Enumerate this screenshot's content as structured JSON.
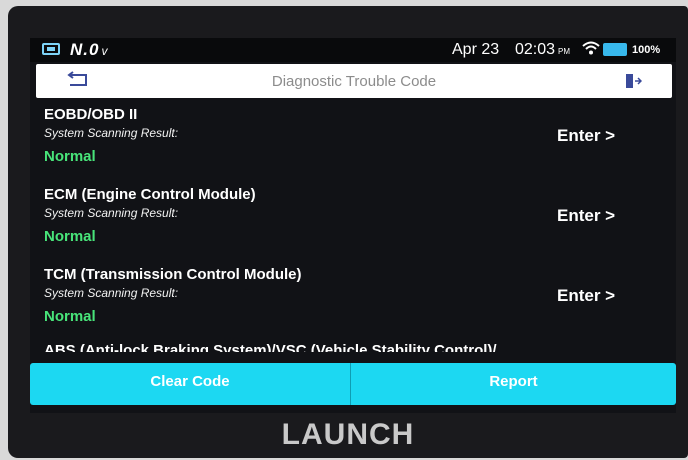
{
  "status_bar": {
    "voltage": "N.0",
    "voltage_unit": "v",
    "date": "Apr 23",
    "time": "02:03",
    "ampm": "PM",
    "battery_percent": "100%"
  },
  "header": {
    "title": "Diagnostic Trouble Code"
  },
  "modules": [
    {
      "title": "EOBD/OBD II",
      "subtitle": "System Scanning Result:",
      "status": "Normal",
      "action": "Enter >"
    },
    {
      "title": "ECM (Engine Control Module)",
      "subtitle": "System Scanning Result:",
      "status": "Normal",
      "action": "Enter >"
    },
    {
      "title": "TCM (Transmission Control Module)",
      "subtitle": "System Scanning Result:",
      "status": "Normal",
      "action": "Enter >"
    },
    {
      "title": "ABS (Anti-lock Braking System)/VSC (Vehicle Stability Control)/"
    }
  ],
  "footer": {
    "clear_label": "Clear Code",
    "report_label": "Report"
  },
  "device": {
    "brand": "LAUNCH"
  },
  "colors": {
    "accent": "#1cd8f2",
    "status_ok": "#48e57a",
    "background": "#111216"
  }
}
